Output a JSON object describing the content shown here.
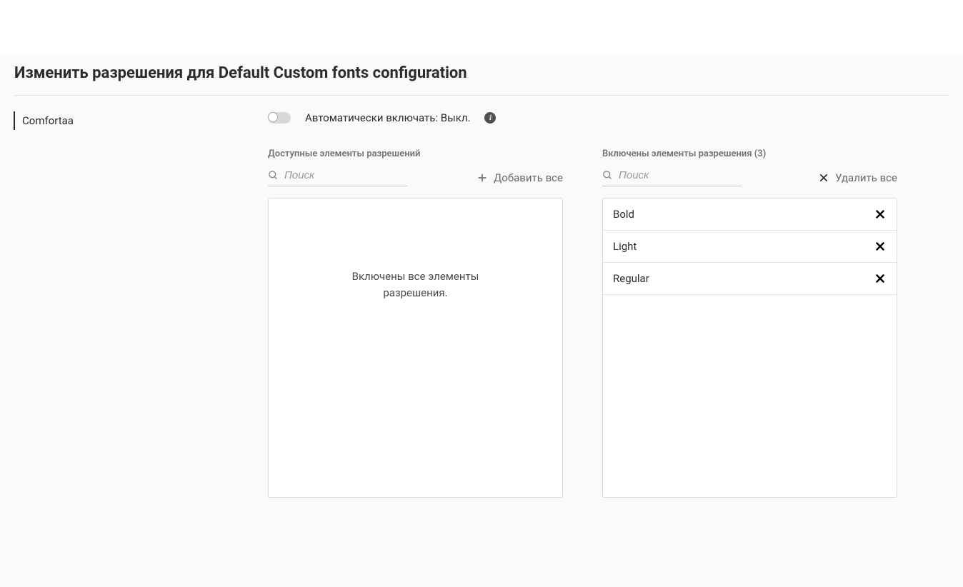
{
  "page": {
    "title": "Изменить разрешения для Default Custom fonts configuration"
  },
  "sidebar": {
    "items": [
      {
        "label": "Comfortaa"
      }
    ]
  },
  "toggle": {
    "label": "Автоматически включать: Выкл."
  },
  "available": {
    "header": "Доступные элементы разрешений",
    "search_placeholder": "Поиск",
    "add_all_label": "Добавить все",
    "empty_message_line1": "Включены все элементы",
    "empty_message_line2": "разрешения."
  },
  "enabled": {
    "header": "Включены элементы разрешения (3)",
    "search_placeholder": "Поиск",
    "remove_all_label": "Удалить все",
    "items": [
      {
        "label": "Bold"
      },
      {
        "label": "Light"
      },
      {
        "label": "Regular"
      }
    ]
  }
}
